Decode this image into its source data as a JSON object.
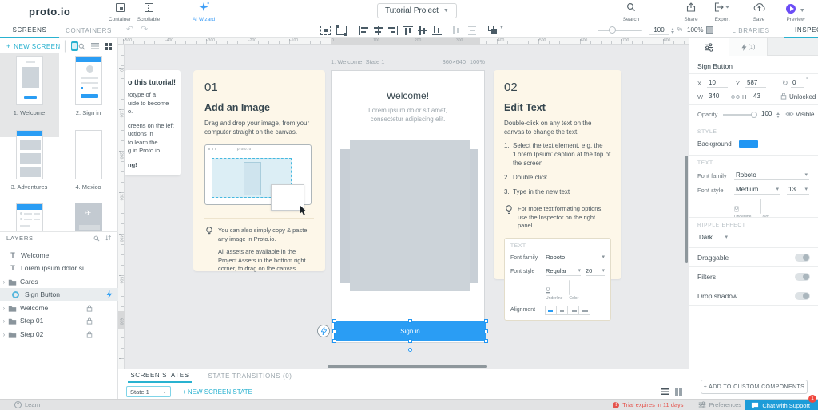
{
  "topbar": {
    "logo": "proto.io",
    "container_label": "Container",
    "scrollable_label": "Scrollable",
    "ai_wizard_label": "AI Wizard",
    "project_name": "Tutorial Project",
    "search_label": "Search",
    "share_label": "Share",
    "export_label": "Export",
    "save_label": "Save",
    "preview_label": "Preview"
  },
  "toolbar": {
    "zoom_value": "100",
    "percent_sign": "%",
    "zoom_readout": "100%"
  },
  "left_panel": {
    "tab_screens": "SCREENS",
    "tab_containers": "CONTAINERS",
    "plus": "+",
    "new_screen_label": "NEW SCREEN",
    "screens": [
      {
        "label": "1. Welcome"
      },
      {
        "label": "2. Sign in"
      },
      {
        "label": "3. Adventures"
      },
      {
        "label": "4. Mexico"
      }
    ],
    "layers_header": "LAYERS",
    "layers": [
      {
        "label": "Welcome!"
      },
      {
        "label": "Lorem ipsum dolor si.."
      },
      {
        "label": "Cards"
      },
      {
        "label": "Sign Button"
      },
      {
        "label": "Welcome"
      },
      {
        "label": "Step 01"
      },
      {
        "label": "Step 02"
      }
    ]
  },
  "canvas": {
    "h_ruler": [
      "-500",
      "-400",
      "-300",
      "-200",
      "-100",
      "0",
      "100",
      "200",
      "300",
      "400",
      "500",
      "600",
      "700",
      "800"
    ],
    "v_ruler": [
      "0",
      "100",
      "200",
      "300",
      "400",
      "500",
      "600"
    ],
    "partial_card": {
      "line_title": "o this tutorial!",
      "p1": [
        "totype of a",
        "uide to become",
        "o."
      ],
      "p2": [
        "creens on the left",
        "uctions in",
        "to learn the",
        "g in Proto.io."
      ],
      "p3": "ng!"
    },
    "card1": {
      "number": "01",
      "title": "Add an Image",
      "body": "Drag and drop your image, from your computer straight on the canvas.",
      "browser_label": "proto.io",
      "tip1": "You can also simply copy & paste any image in Proto.io.",
      "tip2": "All assets are available in the Project Assets in the bottom right corner, to drag on the canvas."
    },
    "screen": {
      "header_left": "1. Welcome: State 1",
      "header_size": "360×640",
      "header_zoom": "100%",
      "title": "Welcome!",
      "subtitle_l1": "Lorem ipsum dolor sit amet,",
      "subtitle_l2": "consectetur adipiscing elit.",
      "button_label": "Sign in"
    },
    "card2": {
      "number": "02",
      "title": "Edit Text",
      "body": "Double-click on any text on the canvas to change the text.",
      "steps": [
        {
          "n": "1.",
          "text": "Select the text element, e.g. the 'Lorem Ipsum' caption at the top of the screen"
        },
        {
          "n": "2.",
          "text": "Double click"
        },
        {
          "n": "3.",
          "text": "Type in the new text"
        }
      ],
      "tip": "For more text formating options, use the Inspector on the right panel.",
      "mini_panel": {
        "header": "TEXT",
        "font_family_label": "Font family",
        "font_family_value": "Roboto",
        "font_style_label": "Font style",
        "font_style_value": "Regular",
        "font_size_value": "20",
        "underline_glyph": "U",
        "underline_label": "Underline",
        "color_label": "Color",
        "alignment_label": "Alignment"
      }
    }
  },
  "inspector": {
    "tab_libraries": "LIBRARIES",
    "tab_inspector": "INSPECTOR",
    "interactions_count": "(1)",
    "element_name": "Sign Button",
    "x_label": "X",
    "x_value": "10",
    "y_label": "Y",
    "y_value": "587",
    "rotation_value": "0",
    "degree_sign": "°",
    "w_label": "W",
    "w_value": "340",
    "h_label": "H",
    "h_value": "43",
    "lock_label": "Unlocked",
    "opacity_label": "Opacity",
    "opacity_value": "100",
    "visible_label": "Visible",
    "style_header": "STYLE",
    "background_label": "Background",
    "background_color": "#2196f3",
    "text_header": "TEXT",
    "font_family_label": "Font family",
    "font_family_value": "Roboto",
    "font_style_label": "Font style",
    "font_style_value": "Medium",
    "font_size_value": "13",
    "underline_glyph": "U",
    "underline_label": "Underline",
    "color_label": "Color",
    "ripple_header": "RIPPLE EFFECT",
    "ripple_value": "Dark",
    "toggles": [
      {
        "label": "Draggable"
      },
      {
        "label": "Filters"
      },
      {
        "label": "Drop shadow"
      }
    ],
    "add_components_label": "+  ADD TO CUSTOM COMPONENTS"
  },
  "states_bar": {
    "tab_states": "SCREEN STATES",
    "tab_transitions": "STATE TRANSITIONS (0)",
    "state_value": "State 1",
    "plus": "+",
    "new_state_label": "NEW SCREEN STATE"
  },
  "status_bar": {
    "learn_label": "Learn",
    "trial_label": "Trial expires in 11 days",
    "preferences_label": "Preferences",
    "chat_label": "Chat with Support",
    "chat_badge": "1"
  }
}
